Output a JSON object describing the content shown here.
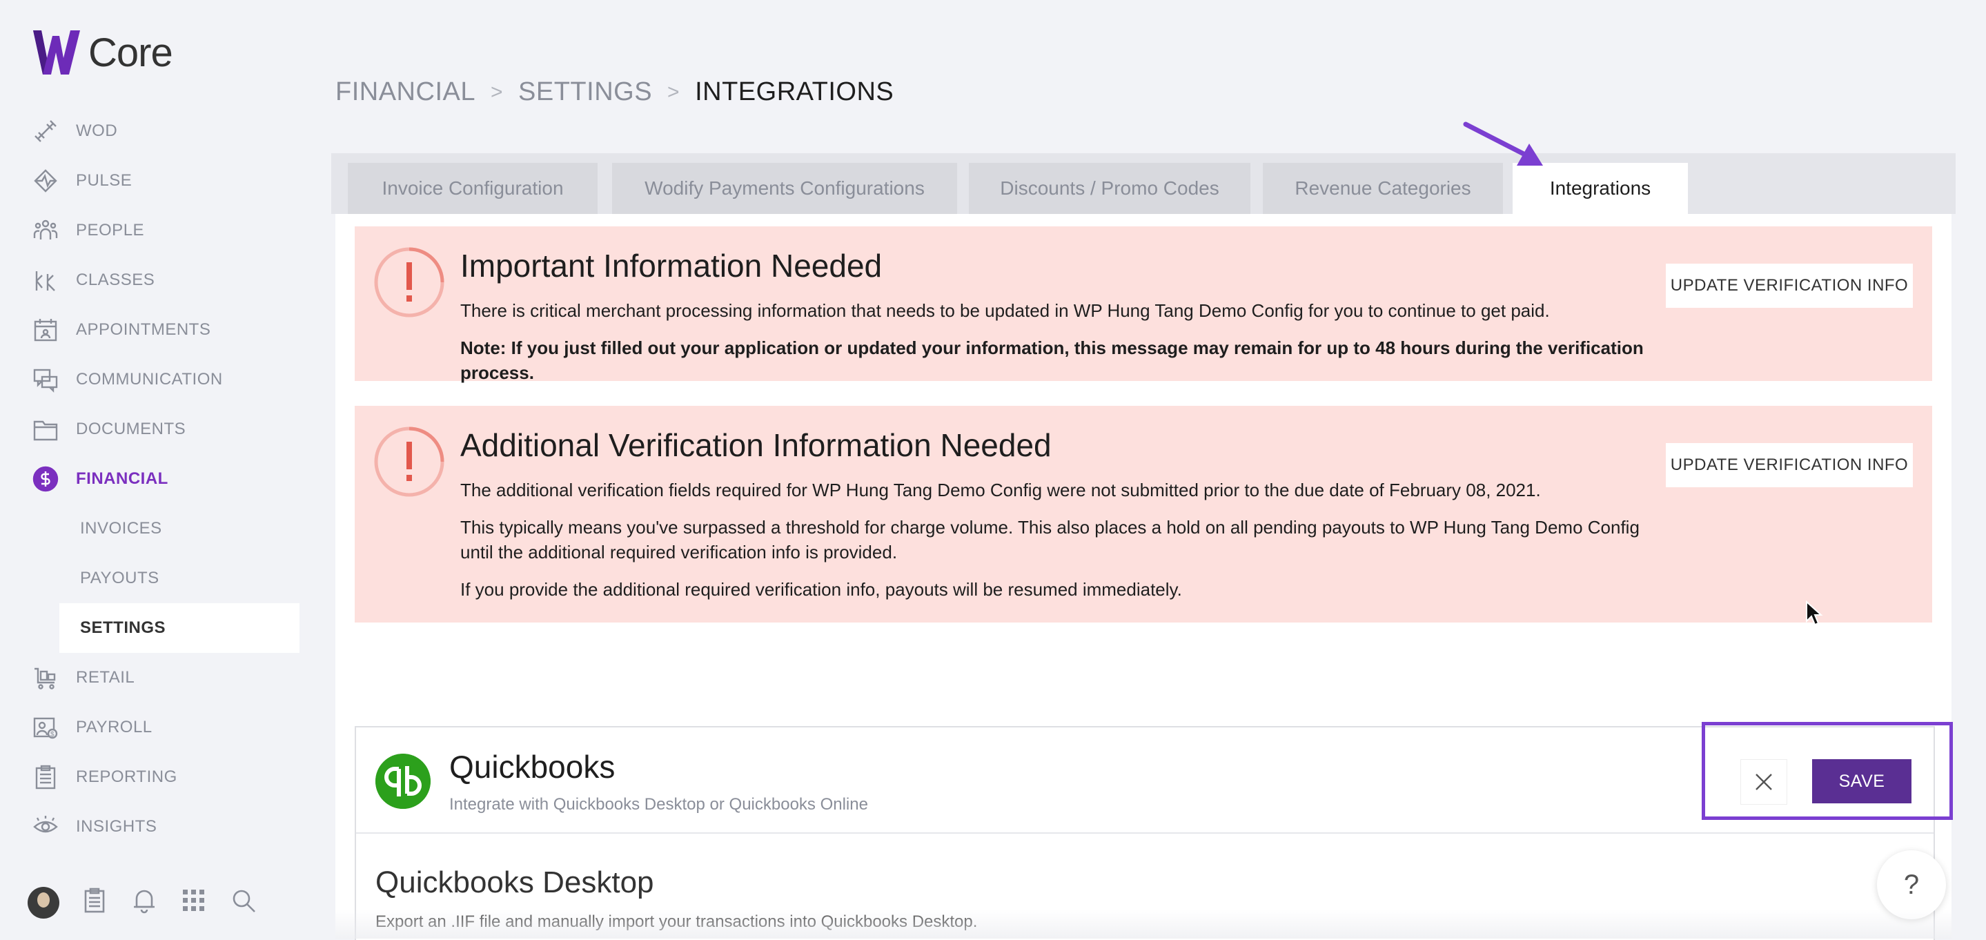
{
  "app": {
    "logo_text": "Core"
  },
  "sidebar": {
    "items": [
      {
        "label": "WOD",
        "icon": "dumbbell-icon"
      },
      {
        "label": "PULSE",
        "icon": "pulse-icon"
      },
      {
        "label": "PEOPLE",
        "icon": "people-icon"
      },
      {
        "label": "CLASSES",
        "icon": "classes-icon"
      },
      {
        "label": "APPOINTMENTS",
        "icon": "calendar-icon"
      },
      {
        "label": "COMMUNICATION",
        "icon": "chat-icon"
      },
      {
        "label": "DOCUMENTS",
        "icon": "folder-icon"
      },
      {
        "label": "FINANCIAL",
        "icon": "dollar-icon"
      }
    ],
    "financial_sub": [
      {
        "label": "INVOICES"
      },
      {
        "label": "PAYOUTS"
      },
      {
        "label": "SETTINGS"
      }
    ],
    "items_after": [
      {
        "label": "RETAIL",
        "icon": "cart-icon"
      },
      {
        "label": "PAYROLL",
        "icon": "payroll-icon"
      },
      {
        "label": "REPORTING",
        "icon": "clipboard-icon"
      },
      {
        "label": "INSIGHTS",
        "icon": "eye-icon"
      }
    ]
  },
  "breadcrumb": {
    "first": "FINANCIAL",
    "second": "SETTINGS",
    "third": "INTEGRATIONS"
  },
  "tabs": [
    {
      "label": "Invoice Configuration"
    },
    {
      "label": "Wodify Payments Configurations"
    },
    {
      "label": "Discounts / Promo Codes"
    },
    {
      "label": "Revenue Categories"
    },
    {
      "label": "Integrations"
    }
  ],
  "alerts": {
    "first": {
      "title": "Important Information Needed",
      "text": "There is critical merchant processing information that needs to be updated in WP Hung Tang Demo Config for you to continue to get paid.",
      "note": "Note: If you just filled out your application or updated your information, this message may remain for up to 48 hours during the verification process.",
      "button": "UPDATE VERIFICATION INFO"
    },
    "second": {
      "title": "Additional Verification Information Needed",
      "text1": "The additional verification fields required for WP Hung Tang Demo Config were not submitted prior to the due date of February 08, 2021.",
      "text2": "This typically means you've surpassed a threshold for charge volume. This also places a hold on all pending payouts to WP Hung Tang Demo Config until the additional required verification info is provided.",
      "text3": "If you provide the additional required verification info, payouts will be resumed immediately.",
      "button": "UPDATE VERIFICATION INFO"
    },
    "icon_glyph": "!"
  },
  "quickbooks": {
    "title": "Quickbooks",
    "subtitle": "Integrate with Quickbooks Desktop or Quickbooks Online",
    "desktop_title": "Quickbooks Desktop",
    "desktop_text": "Export an .IIF file and manually import your transactions into Quickbooks Desktop.",
    "save_label": "SAVE"
  },
  "help": {
    "label": "?"
  },
  "colors": {
    "accent": "#7b2fbf",
    "save": "#5a2f93",
    "alert_bg": "#fde0dd",
    "qb_green": "#2ca01c"
  }
}
